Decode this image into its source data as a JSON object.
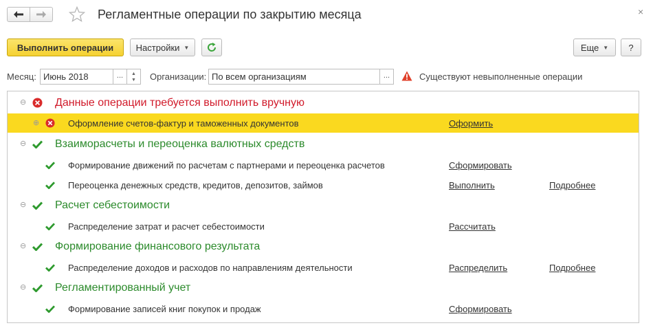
{
  "header": {
    "title": "Регламентные операции по закрытию месяца",
    "close_symbol": "×"
  },
  "toolbar": {
    "run_label": "Выполнить операции",
    "settings_label": "Настройки",
    "more_label": "Еще",
    "help_label": "?"
  },
  "filters": {
    "month_label": "Месяц:",
    "month_value": "Июнь 2018",
    "org_label": "Организации:",
    "org_value": "По всем организациям",
    "warning_text": "Существуют невыполненные операции",
    "dots": "..."
  },
  "groups": [
    {
      "title": "Данные операции требуется выполнить вручную",
      "status": "error",
      "items": [
        {
          "label": "Оформление счетов-фактур и таможенных документов",
          "action": "Оформить",
          "details": "",
          "status": "error",
          "selected": true
        }
      ]
    },
    {
      "title": "Взаиморасчеты и переоценка валютных средств",
      "status": "done",
      "items": [
        {
          "label": "Формирование движений по расчетам с партнерами и переоценка расчетов",
          "action": "Сформировать",
          "details": "",
          "status": "done",
          "selected": false
        },
        {
          "label": "Переоценка денежных средств, кредитов, депозитов, займов",
          "action": "Выполнить",
          "details": "Подробнее",
          "status": "done",
          "selected": false
        }
      ]
    },
    {
      "title": "Расчет себестоимости",
      "status": "done",
      "items": [
        {
          "label": "Распределение затрат и расчет себестоимости",
          "action": "Рассчитать",
          "details": "",
          "status": "done",
          "selected": false
        }
      ]
    },
    {
      "title": "Формирование финансового результата",
      "status": "done",
      "items": [
        {
          "label": "Распределение доходов и расходов по направлениям деятельности",
          "action": "Распределить",
          "details": "Подробнее",
          "status": "done",
          "selected": false
        }
      ]
    },
    {
      "title": "Регламентированный учет",
      "status": "done",
      "items": [
        {
          "label": "Формирование записей книг покупок и продаж",
          "action": "Сформировать",
          "details": "",
          "status": "done",
          "selected": false
        }
      ]
    }
  ],
  "colors": {
    "accent_yellow": "#fad91f",
    "error_red": "#d11a2a",
    "success_green": "#2b8a2b",
    "refresh_green": "#3aa53a"
  }
}
